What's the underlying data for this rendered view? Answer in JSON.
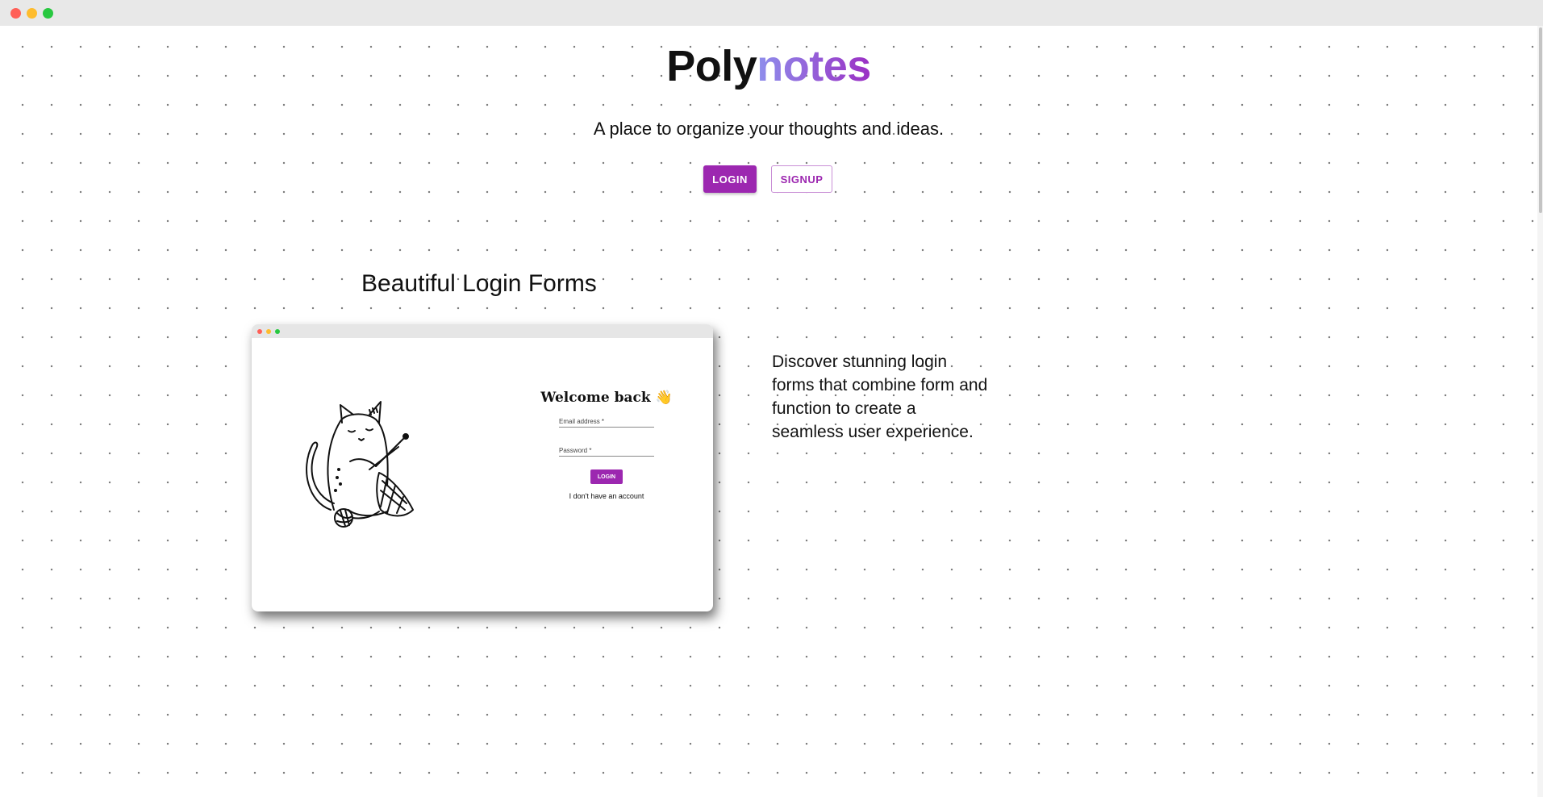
{
  "window": {
    "controls": [
      "close",
      "minimize",
      "maximize"
    ]
  },
  "hero": {
    "brand_prefix": "Poly",
    "brand_suffix": "notes",
    "tagline": "A place to organize your thoughts and ideas.",
    "login_label": "LOGIN",
    "signup_label": "SIGNUP"
  },
  "feature": {
    "title": "Beautiful Login Forms",
    "description": "Discover stunning login forms that combine form and function to create a seamless user experience.",
    "preview": {
      "welcome_text": "Welcome back",
      "wave_icon": "👋",
      "email_label": "Email address *",
      "password_label": "Password *",
      "login_label": "LOGIN",
      "no_account_text": "I don't have an account"
    }
  },
  "colors": {
    "primary": "#9c27b0",
    "gradient_start": "#8e8fec",
    "gradient_end": "#9b2fc4"
  }
}
